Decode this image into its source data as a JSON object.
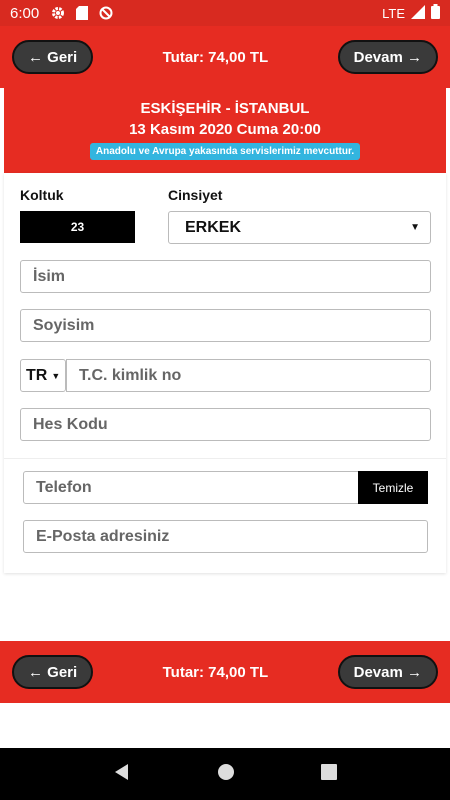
{
  "status_bar": {
    "time": "6:00",
    "network": "LTE"
  },
  "nav": {
    "back_label": "← Geri",
    "next_label": "Devam →",
    "total": "Tutar: 74,00 TL"
  },
  "route": {
    "title": "ESKİŞEHİR - İSTANBUL",
    "datetime": "13 Kasım 2020 Cuma 20:00",
    "notice": "Anadolu ve Avrupa yakasında servislerimiz mevcuttur."
  },
  "form": {
    "seat_label": "Koltuk",
    "seat_value": "23",
    "gender_label": "Cinsiyet",
    "gender_value": "ERKEK",
    "name_placeholder": "İsim",
    "surname_placeholder": "Soyisim",
    "country_code": "TR",
    "tc_placeholder": "T.C. kimlik no",
    "hes_placeholder": "Hes Kodu",
    "phone_placeholder": "Telefon",
    "clear_label": "Temizle",
    "email_placeholder": "E-Posta adresiniz"
  },
  "colors": {
    "brand_red": "#e62c22",
    "notice_blue": "#33b5df",
    "dark_button": "#3a3a3a"
  },
  "icons": [
    "settings-icon",
    "sd-card-icon",
    "blocked-icon",
    "signal-icon",
    "battery-icon",
    "back-icon",
    "home-icon",
    "recents-icon"
  ]
}
